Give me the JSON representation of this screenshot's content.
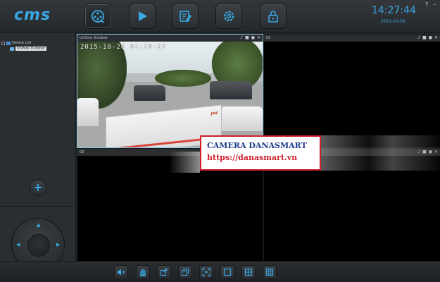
{
  "app": {
    "logo": "cms"
  },
  "clock": {
    "time": "14:27:44",
    "date": "2015-10-26"
  },
  "window_controls": {
    "help": "?",
    "minimize": "–"
  },
  "nav": [
    {
      "id": "live",
      "icon": "film-reel-icon",
      "active": true
    },
    {
      "id": "playback",
      "icon": "play-icon",
      "active": false
    },
    {
      "id": "log",
      "icon": "edit-icon",
      "active": false
    },
    {
      "id": "settings",
      "icon": "gear-icon",
      "active": false
    },
    {
      "id": "lock",
      "icon": "lock-icon",
      "active": false
    }
  ],
  "device_tree": {
    "root": "Device List",
    "child": "Unifore Outdoor"
  },
  "panes": [
    {
      "id": "01",
      "title": "Unifore Outdoor",
      "osd": "2015-10-26  02:28:23"
    },
    {
      "id": "02",
      "title": "02"
    },
    {
      "id": "03",
      "title": "03"
    },
    {
      "id": "04",
      "title": "04"
    }
  ],
  "feed": {
    "truck_brand": "JMC"
  },
  "watermark": {
    "line1": "CAMERA DANASMART",
    "line2": "https://danasmart.vn"
  },
  "toolbar": [
    "mute-icon",
    "stop-icon",
    "capture-icon",
    "record-icon",
    "fullscreen-icon",
    "layout-1-icon",
    "layout-4-icon",
    "layout-9-icon"
  ],
  "colors": {
    "accent": "#39a9e6",
    "watermark_border": "#d01f2a",
    "watermark_text": "#1e3c8c"
  }
}
